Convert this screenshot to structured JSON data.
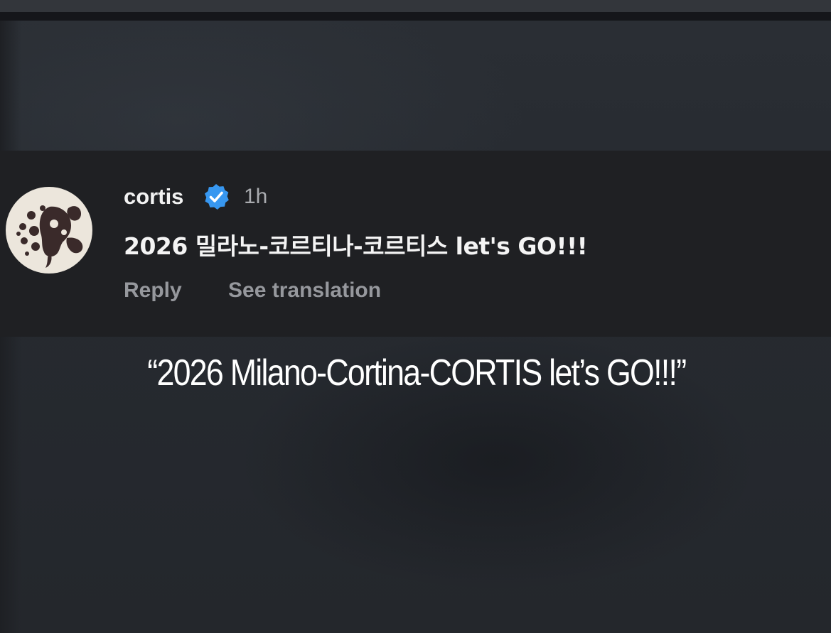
{
  "comment": {
    "username": "cortis",
    "verified_icon": "verified-badge-icon",
    "timestamp": "1h",
    "text": "2026 밀라노-코르티나-코르티스 let's GO!!!",
    "reply_label": "Reply",
    "translate_label": "See translation"
  },
  "caption": {
    "text": "“2026 Milano-Cortina-CORTIS let’s GO!!!”"
  },
  "colors": {
    "card_background": "#1f2023",
    "verified_blue": "#3797f0",
    "secondary_text": "#96989d",
    "avatar_background": "#ece6dc",
    "avatar_logo": "#3a2a2a"
  }
}
